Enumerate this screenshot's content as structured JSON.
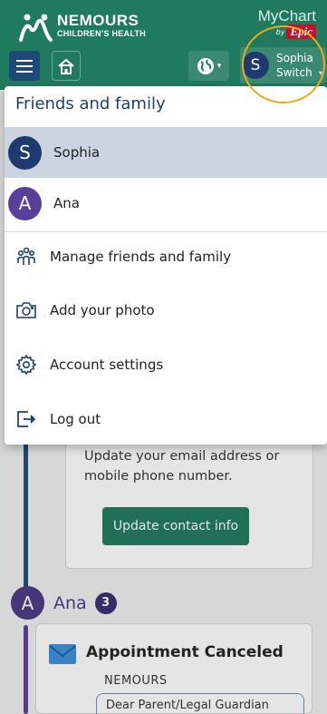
{
  "header": {
    "brand_name": "NEMOURS",
    "brand_sub": "CHILDREN'S HEALTH",
    "app_name": "MyChart",
    "by_text": "by",
    "epic_badge": "Epic",
    "globe_caret": "▾",
    "switcher": {
      "avatar_initial": "S",
      "name": "Sophia",
      "action": "Switch",
      "caret": "▾"
    }
  },
  "dropdown": {
    "title": "Friends and family",
    "people": [
      {
        "initial": "S",
        "name": "Sophia",
        "color": "#1e3a6e",
        "selected": true
      },
      {
        "initial": "A",
        "name": "Ana",
        "color": "#5a3f9a",
        "selected": false
      }
    ],
    "items": [
      {
        "icon": "people-icon",
        "label": "Manage friends and family"
      },
      {
        "icon": "camera-icon",
        "label": "Add your photo"
      },
      {
        "icon": "gear-icon",
        "label": "Account settings"
      },
      {
        "icon": "logout-icon",
        "label": "Log out"
      }
    ]
  },
  "background": {
    "contact_card": {
      "text": "Update your email address or mobile phone number.",
      "button": "Update contact info"
    },
    "ana_section": {
      "initial": "A",
      "name": "Ana",
      "count": "3"
    },
    "appointment_card": {
      "title": "Appointment Canceled",
      "org": "NEMOURS",
      "message": "Dear Parent/Legal Guardian"
    }
  },
  "colors": {
    "header_green": "#1f7a5e",
    "navy": "#1e3a6e",
    "purple": "#5a3f9a",
    "highlight_circle": "#f0a81c",
    "selected_row": "#ccd4e0"
  }
}
